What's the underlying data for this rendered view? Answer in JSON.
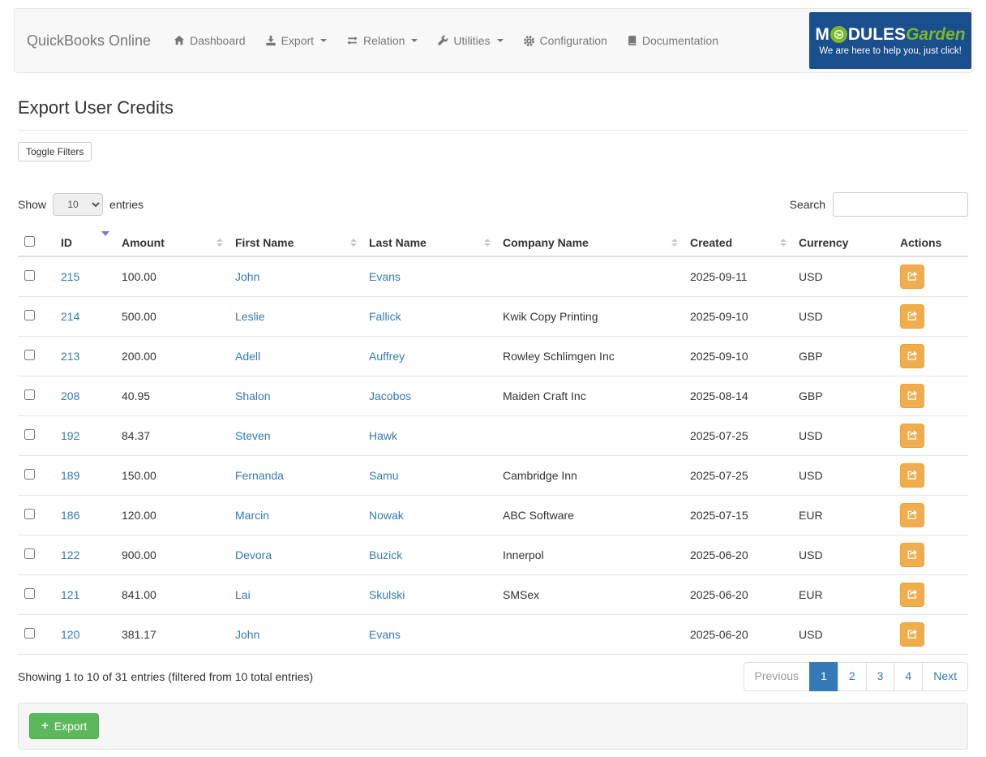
{
  "navbar": {
    "brand": "QuickBooks Online",
    "items": [
      {
        "label": "Dashboard",
        "icon": "home-icon",
        "caret": false
      },
      {
        "label": "Export",
        "icon": "export-icon",
        "caret": true
      },
      {
        "label": "Relation",
        "icon": "exchange-icon",
        "caret": true
      },
      {
        "label": "Utilities",
        "icon": "wrench-icon",
        "caret": true
      },
      {
        "label": "Configuration",
        "icon": "gear-icon",
        "caret": false
      },
      {
        "label": "Documentation",
        "icon": "book-icon",
        "caret": false
      }
    ],
    "logo": {
      "word_m": "M",
      "word_dules": "DULES",
      "word_garden": "Garden",
      "tagline": "We are here to help you, just click!",
      "bg_color": "#1a4e8c",
      "green_color": "#7ab829"
    }
  },
  "page": {
    "title": "Export User Credits",
    "toggle_filters_label": "Toggle Filters"
  },
  "table_controls": {
    "show_label": "Show",
    "entries_label": "entries",
    "page_size_value": "10",
    "search_label": "Search",
    "search_value": ""
  },
  "table": {
    "columns": [
      {
        "label": "",
        "type": "select-all-checkbox"
      },
      {
        "label": "ID",
        "sort": "desc-active"
      },
      {
        "label": "Amount",
        "sort": "both"
      },
      {
        "label": "First Name",
        "sort": "both"
      },
      {
        "label": "Last Name",
        "sort": "both"
      },
      {
        "label": "Company Name",
        "sort": "both"
      },
      {
        "label": "Created",
        "sort": "both"
      },
      {
        "label": "Currency",
        "sort": "none"
      },
      {
        "label": "Actions",
        "sort": "none"
      }
    ],
    "rows": [
      {
        "id": "215",
        "amount": "100.00",
        "first_name": "John",
        "last_name": "Evans",
        "company": "",
        "created": "2025-09-11",
        "currency": "USD"
      },
      {
        "id": "214",
        "amount": "500.00",
        "first_name": "Leslie",
        "last_name": "Fallick",
        "company": "Kwik Copy Printing",
        "created": "2025-09-10",
        "currency": "USD"
      },
      {
        "id": "213",
        "amount": "200.00",
        "first_name": "Adell",
        "last_name": "Auffrey",
        "company": "Rowley Schlimgen Inc",
        "created": "2025-09-10",
        "currency": "GBP"
      },
      {
        "id": "208",
        "amount": "40.95",
        "first_name": "Shalon",
        "last_name": "Jacobos",
        "company": "Maiden Craft Inc",
        "created": "2025-08-14",
        "currency": "GBP"
      },
      {
        "id": "192",
        "amount": "84.37",
        "first_name": "Steven",
        "last_name": "Hawk",
        "company": "",
        "created": "2025-07-25",
        "currency": "USD"
      },
      {
        "id": "189",
        "amount": "150.00",
        "first_name": "Fernanda",
        "last_name": "Samu",
        "company": "Cambridge Inn",
        "created": "2025-07-25",
        "currency": "USD"
      },
      {
        "id": "186",
        "amount": "120.00",
        "first_name": "Marcin",
        "last_name": "Nowak",
        "company": "ABC Software",
        "created": "2025-07-15",
        "currency": "EUR"
      },
      {
        "id": "122",
        "amount": "900.00",
        "first_name": "Devora",
        "last_name": "Buzick",
        "company": "Innerpol",
        "created": "2025-06-20",
        "currency": "USD"
      },
      {
        "id": "121",
        "amount": "841.00",
        "first_name": "Lai",
        "last_name": "Skulski",
        "company": "SMSex",
        "created": "2025-06-20",
        "currency": "EUR"
      },
      {
        "id": "120",
        "amount": "381.17",
        "first_name": "John",
        "last_name": "Evans",
        "company": "",
        "created": "2025-06-20",
        "currency": "USD"
      }
    ]
  },
  "table_footer": {
    "summary": "Showing 1 to 10 of 31 entries (filtered from 10 total entries)",
    "pagination": {
      "previous_label": "Previous",
      "pages": [
        "1",
        "2",
        "3",
        "4"
      ],
      "active_page": "1",
      "next_label": "Next"
    }
  },
  "footer_panel": {
    "export_button_label": "Export"
  },
  "colors": {
    "link": "#337ab7",
    "action_button": "#f0ad4e",
    "export_button": "#5cb85c",
    "active_sort_arrow": "#7577d1",
    "navbar_bg": "#f8f8f8"
  }
}
